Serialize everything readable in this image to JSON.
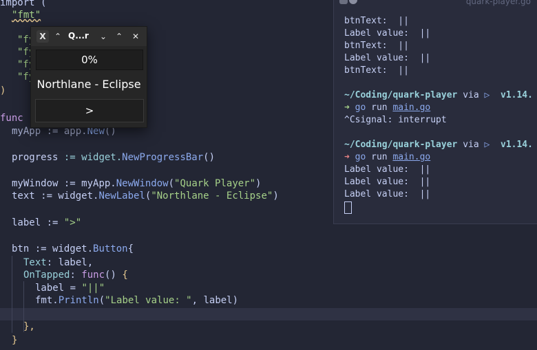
{
  "editor": {
    "line_import": "import (",
    "line_fmt": "\"fmt\"",
    "line_fy1": "\"fy",
    "line_fy2": "\"fy",
    "line_fy3": "\"fy",
    "line_fy4": "\"fy",
    "line_paren": ")",
    "line_func": "func",
    "line_myapp_a": "myApp",
    "line_myapp_b": " := app.",
    "line_myapp_c": "New",
    "line_myapp_d": "()",
    "line_progress_a": "progress",
    "line_progress_b": " := widget.",
    "line_progress_c": "NewProgressBar",
    "line_progress_d": "()",
    "line_window_a": "myWindow",
    "line_window_b": " := myApp.",
    "line_window_c": "NewWindow",
    "line_window_d": "(",
    "line_window_e": "\"Quark Player\"",
    "line_window_f": ")",
    "line_text_a": "text",
    "line_text_b": " := widget.",
    "line_text_c": "NewLabel",
    "line_text_d": "(",
    "line_text_e": "\"Northlane - Eclipse\"",
    "line_text_f": ")",
    "line_label_a": "label",
    "line_label_b": " := ",
    "line_label_c": "\">\"",
    "line_btn_a": "btn",
    "line_btn_b": " := widget.",
    "line_btn_c": "Button",
    "line_btn_d": "{",
    "line_textf_a": "Text",
    "line_textf_b": ": label,",
    "line_ontap_a": "OnTapped",
    "line_ontap_b": ": ",
    "line_ontap_c": "func",
    "line_ontap_d": "() ",
    "line_ontap_e": "{",
    "line_assign_a": "label = ",
    "line_assign_b": "\"||\"",
    "line_print_a": "fmt.",
    "line_print_b": "Println",
    "line_print_c": "(",
    "line_print_d": "\"Label value: \"",
    "line_print_e": ", label)",
    "line_close1": "},",
    "line_close2": "}"
  },
  "app_window": {
    "title": "Q...r",
    "x_logo": "X",
    "progress_text": "0%",
    "label_text": "Northlane - Eclipse",
    "button_label": ">"
  },
  "terminal": {
    "title": "quark-player.go",
    "lines": [
      "btnText:  ||",
      "Label value:  ||",
      "btnText:  ||",
      "Label value:  ||",
      "btnText:  ||"
    ],
    "prompt1_path": "~/Coding/quark-player",
    "prompt_via": " via ",
    "prompt_ver": "v1.14.",
    "prompt_arrow": "➜",
    "prompt_cmd": "go",
    "prompt_run": " run ",
    "prompt_file": "main.go",
    "signal_line": "^Csignal: interrupt",
    "prompt2_path": "~/Coding/quark-player",
    "after_lines": [
      "Label value:  ||",
      "Label value:  ||",
      "Label value:  ||"
    ]
  }
}
